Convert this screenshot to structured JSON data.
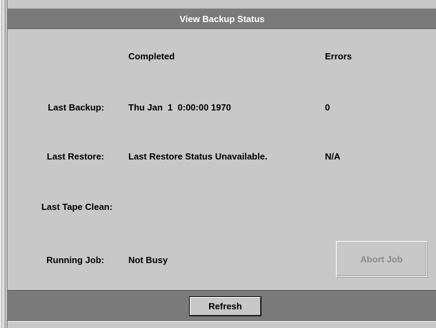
{
  "window": {
    "title": "View Backup Status"
  },
  "columns": {
    "completed": "Completed",
    "errors": "Errors"
  },
  "rows": [
    {
      "label": "Last Backup:",
      "completed": "Thu Jan  1  0:00:00 1970",
      "errors": "0"
    },
    {
      "label": "Last Restore:",
      "completed": "Last Restore Status Unavailable.",
      "errors": "N/A"
    },
    {
      "label": "Last Tape Clean:",
      "completed": "",
      "errors": ""
    }
  ],
  "running_job": {
    "label": "Running Job:",
    "status": "Not Busy"
  },
  "buttons": {
    "abort_label": "Abort Job",
    "refresh_label": "Refresh"
  }
}
